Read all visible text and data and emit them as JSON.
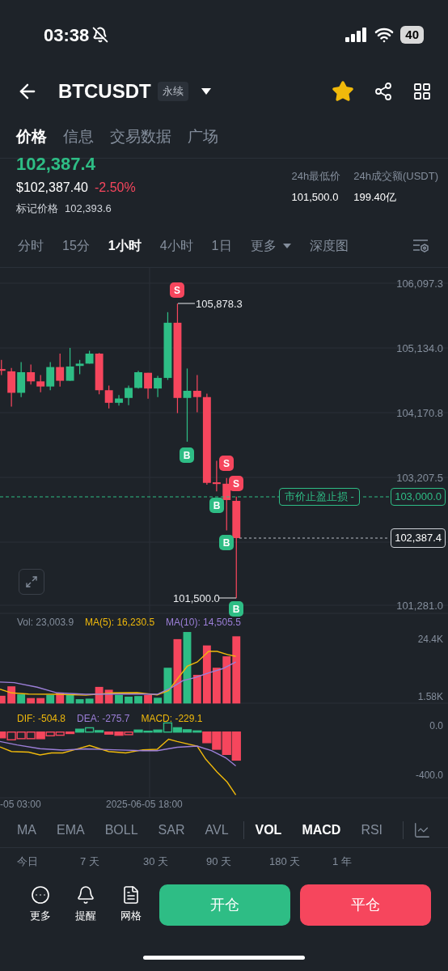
{
  "status_bar": {
    "time": "03:38",
    "battery": "40"
  },
  "header": {
    "symbol": "BTCUSDT",
    "badge": "永续",
    "favorite": true
  },
  "tabs": [
    {
      "label": "价格",
      "selected": true
    },
    {
      "label": "信息",
      "selected": false
    },
    {
      "label": "交易数据",
      "selected": false
    },
    {
      "label": "广场",
      "selected": false
    }
  ],
  "price": {
    "last": "102,387.4",
    "usd": "$102,387.40",
    "change": "-2.50%",
    "mark_label": "标记价格",
    "mark_value": "102,393.6"
  },
  "stats": [
    {
      "label": "24h最低价",
      "value": "101,500.0"
    },
    {
      "label": "24h成交额(USDT)",
      "value": "199.40亿"
    }
  ],
  "intervals": [
    {
      "label": "分时",
      "selected": false,
      "dropdown": false
    },
    {
      "label": "15分",
      "selected": false,
      "dropdown": false
    },
    {
      "label": "1小时",
      "selected": true,
      "dropdown": false
    },
    {
      "label": "4小时",
      "selected": false,
      "dropdown": false
    },
    {
      "label": "1日",
      "selected": false,
      "dropdown": false
    },
    {
      "label": "更多",
      "selected": false,
      "dropdown": true
    },
    {
      "label": "深度图",
      "selected": false,
      "dropdown": false
    }
  ],
  "chart": {
    "price_ticks": [
      "106,097.3",
      "105,134.0",
      "104,170.8",
      "103,207.5",
      "101,281.0"
    ],
    "high_label": "105,878.3",
    "low_label": "101,500.0",
    "order_line": {
      "label": "市价止盈止损 -",
      "price": "103,000.0"
    },
    "last_price": "102,387.4",
    "markers": [
      {
        "kind": "sell",
        "label": "S"
      },
      {
        "kind": "buy",
        "label": "B"
      },
      {
        "kind": "sell",
        "label": "S"
      },
      {
        "kind": "sell",
        "label": "S"
      },
      {
        "kind": "buy",
        "label": "B"
      },
      {
        "kind": "buy",
        "label": "B"
      },
      {
        "kind": "buy",
        "label": "B"
      }
    ],
    "volume_legend": [
      {
        "label": "Vol: 23,003.9",
        "color": "#848e9c"
      },
      {
        "label": "MA(5): 16,230.5",
        "color": "#f0b90b"
      },
      {
        "label": "MA(10): 14,505.5",
        "color": "#9c7fd8"
      }
    ],
    "volume_ticks": [
      "24.4K",
      "1.58K"
    ],
    "macd_legend": [
      {
        "label": "DIF: -504.8",
        "color": "#f0b90b"
      },
      {
        "label": "DEA: -275.7",
        "color": "#9c7fd8"
      },
      {
        "label": "MACD: -229.1",
        "color": "#f0b90b"
      }
    ],
    "macd_ticks": [
      "0.0",
      "-400.0"
    ],
    "time_labels": [
      "-05 03:00",
      "2025-06-05 18:00"
    ]
  },
  "indicators": [
    {
      "label": "MA",
      "selected": false
    },
    {
      "label": "EMA",
      "selected": false
    },
    {
      "label": "BOLL",
      "selected": false
    },
    {
      "label": "SAR",
      "selected": false
    },
    {
      "label": "AVL",
      "selected": false
    },
    {
      "label": "VOL",
      "selected": true
    },
    {
      "label": "MACD",
      "selected": true
    },
    {
      "label": "RSI",
      "selected": false
    }
  ],
  "ranges": [
    "今日",
    "7 天",
    "30 天",
    "90 天",
    "180 天",
    "1 年"
  ],
  "tools": [
    {
      "label": "更多",
      "kind": "more"
    },
    {
      "label": "提醒",
      "kind": "alert"
    },
    {
      "label": "网格",
      "kind": "grid"
    }
  ],
  "actions": [
    {
      "label": "开仓",
      "kind": "open"
    },
    {
      "label": "平仓",
      "kind": "close"
    }
  ]
}
